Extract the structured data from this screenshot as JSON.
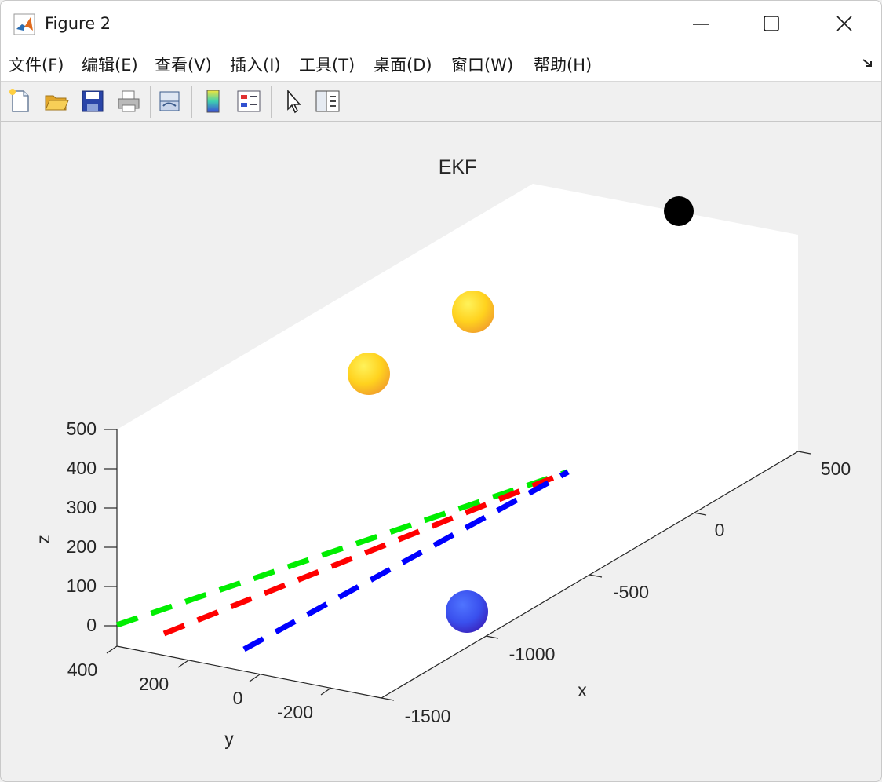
{
  "window": {
    "title": "Figure 2"
  },
  "menu": [
    "文件(F)",
    "编辑(E)",
    "查看(V)",
    "插入(I)",
    "工具(T)",
    "桌面(D)",
    "窗口(W)",
    "帮助(H)"
  ],
  "toolbar": [
    "new-figure-icon",
    "open-folder-icon",
    "save-icon",
    "print-icon",
    "link-icon",
    "colorbar-icon",
    "legend-icon",
    "pointer-icon",
    "property-inspector-icon"
  ],
  "chart_data": {
    "type": "scatter3d",
    "title": "EKF",
    "xlabel": "x",
    "ylabel": "y",
    "zlabel": "z",
    "x_ticks": [
      "-1500",
      "-1000",
      "-500",
      "0",
      "500"
    ],
    "y_ticks": [
      "400",
      "200",
      "0",
      "-200"
    ],
    "z_ticks": [
      "500",
      "400",
      "300",
      "200",
      "100",
      "0"
    ],
    "colors": {
      "green_line": "#00ee00",
      "red_line": "#ff0000",
      "blue_line": "#0000ff",
      "yellow_sphere": "#ffd820",
      "blue_sphere": "#3a50ee",
      "black_marker": "#000000"
    }
  }
}
